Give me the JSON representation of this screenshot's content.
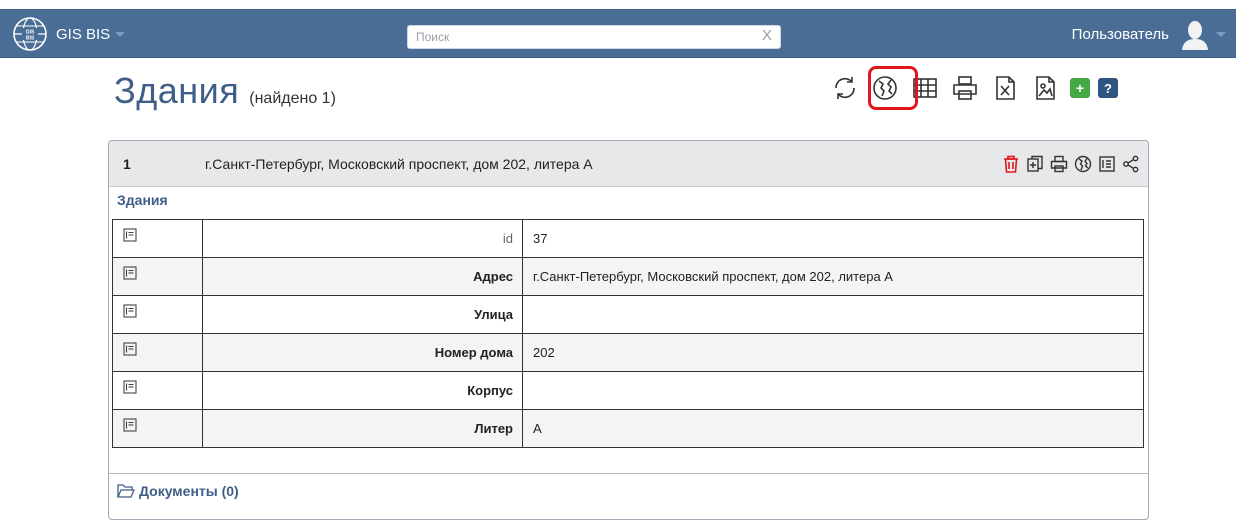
{
  "navbar": {
    "brand_logo_text": "GIS BIS",
    "brand": "GIS BIS",
    "search_placeholder": "Поиск",
    "search_clear": "X",
    "user": "Пользователь"
  },
  "page": {
    "title": "Здания",
    "found": "(найдено 1)"
  },
  "toolbar": {
    "icons": [
      "refresh-icon",
      "globe-icon",
      "table-icon",
      "print-icon",
      "excel-export-icon",
      "image-export-icon",
      "add-icon",
      "help-icon"
    ],
    "add_label": "+",
    "help_label": "?",
    "highlight_color": "#e0161f"
  },
  "record": {
    "number": "1",
    "address": "г.Санкт-Петербург, Московский проспект, дом 202, литера А",
    "actions": [
      "delete-icon",
      "copy-icon",
      "print-icon",
      "globe-icon",
      "details-icon",
      "share-icon"
    ],
    "section": "Здания",
    "fields": [
      {
        "label": "id",
        "value": "37"
      },
      {
        "label": "Адрес",
        "value": "г.Санкт-Петербург, Московский проспект, дом 202, литера А"
      },
      {
        "label": "Улица",
        "value": ""
      },
      {
        "label": "Номер дома",
        "value": "202"
      },
      {
        "label": "Корпус",
        "value": ""
      },
      {
        "label": "Литер",
        "value": "А"
      }
    ],
    "documents": "Документы (0)"
  },
  "colors": {
    "navbar": "#4a6d96",
    "title": "#3f5e87",
    "delete": "#e0161f",
    "add": "#44a942",
    "help": "#2f5482"
  }
}
